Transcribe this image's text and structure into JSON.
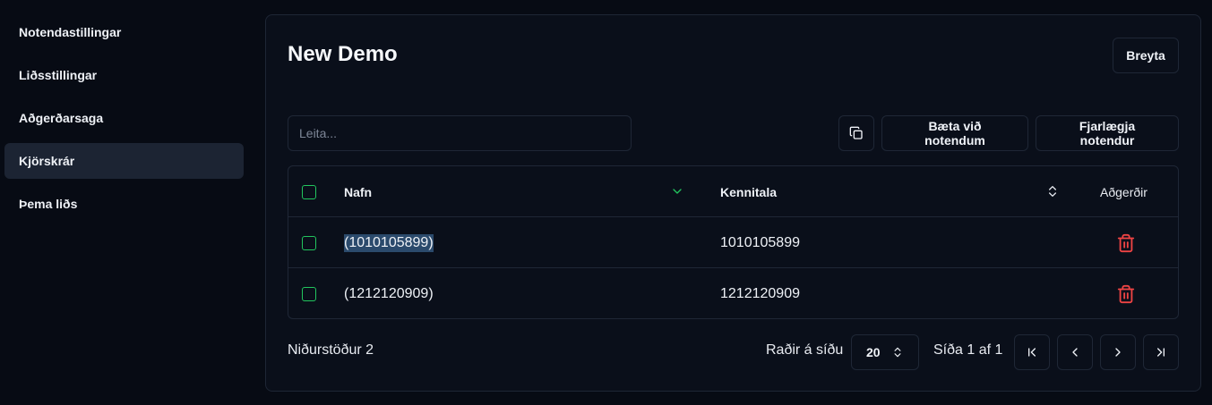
{
  "sidebar": {
    "items": [
      {
        "label": "Notendastillingar"
      },
      {
        "label": "Liðsstillingar"
      },
      {
        "label": "Aðgerðarsaga"
      },
      {
        "label": "Kjörskrár"
      },
      {
        "label": "Þema liðs"
      }
    ],
    "active": "Kjörskrár"
  },
  "panel": {
    "title": "New Demo",
    "edit_label": "Breyta"
  },
  "toolbar": {
    "search_placeholder": "Leita...",
    "search_value": "",
    "copy_icon": "copy-icon",
    "add_label": "Bæta við notendum",
    "remove_label": "Fjarlægja notendur"
  },
  "table": {
    "columns": {
      "name": "Nafn",
      "kennitala": "Kennitala",
      "actions": "Aðgerðir"
    },
    "rows": [
      {
        "name": "(1010105899)",
        "kennitala": "1010105899",
        "selected": false,
        "highlighted": true
      },
      {
        "name": "(1212120909)",
        "kennitala": "1212120909",
        "selected": false,
        "highlighted": false
      }
    ]
  },
  "footer": {
    "results": "Niðurstöður 2",
    "rows_per_page_label": "Raðir á síðu",
    "rows_per_page": "20",
    "page_info": "Síða 1 af 1"
  },
  "colors": {
    "accent_green": "#22c55e",
    "danger_red": "#ef4444",
    "highlight": "#2b4a6c",
    "background": "#070b14"
  }
}
